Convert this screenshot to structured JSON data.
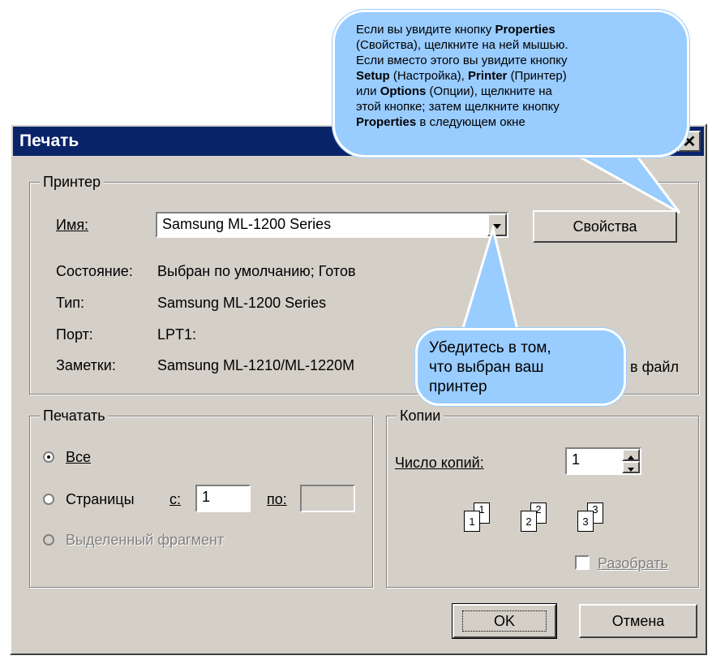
{
  "dialog": {
    "title": "Печать",
    "close_glyph": "✕",
    "printer_group": {
      "legend": "Принтер",
      "name_label": "Имя:",
      "name_value": "Samsung ML-1200 Series",
      "properties_button": "Свойства",
      "status_label": "Состояние:",
      "status_value": "Выбран по умолчанию; Готов",
      "type_label": "Тип:",
      "type_value": "Samsung ML-1200 Series",
      "port_label": "Порт:",
      "port_value": "LPT1:",
      "notes_label": "Заметки:",
      "notes_value": "Samsung ML-1210/ML-1220M",
      "print_to_file_fragment": "в файл"
    },
    "range_group": {
      "legend": "Печатать",
      "all_label": "Все",
      "pages_label": "Страницы",
      "from_label": "с:",
      "from_value": "1",
      "to_label": "по:",
      "to_value": "",
      "selection_label": "Выделенный фрагмент",
      "selected": "all"
    },
    "copies_group": {
      "legend": "Копии",
      "count_label": "Число копий:",
      "count_value": "1",
      "collate_label": "Разобрать",
      "collate_checked": false,
      "collate_icon_pages": [
        "1",
        "1",
        "2",
        "2",
        "3",
        "3"
      ]
    },
    "ok_button": "OK",
    "cancel_button": "Отмена"
  },
  "callouts": {
    "top": {
      "line1": "Если вы увидите кнопку",
      "properties_en": "Properties",
      "line2": "(Свойства), щелкните на ней мышью.",
      "line3": "Если вместо этого вы увидите кнопку",
      "setup_en": "Setup",
      "setup_ru": "(Настройка),",
      "printer_en": "Printer",
      "printer_ru": "(Принтер)",
      "or_word": "или",
      "options_en": "Options",
      "options_ru": "(Опции), щелкните на",
      "line6": "этой кнопке; затем щелкните кнопку",
      "properties_en_2": "Properties",
      "line7_rest": "в следующем окне"
    },
    "bottom": {
      "line1": "Убедитесь в том,",
      "line2": "что выбран ваш",
      "line3": "принтер"
    }
  },
  "colors": {
    "title_bar": "#0a246a",
    "dialog_face": "#d4d0c8",
    "callout_fill": "#99ccff"
  }
}
